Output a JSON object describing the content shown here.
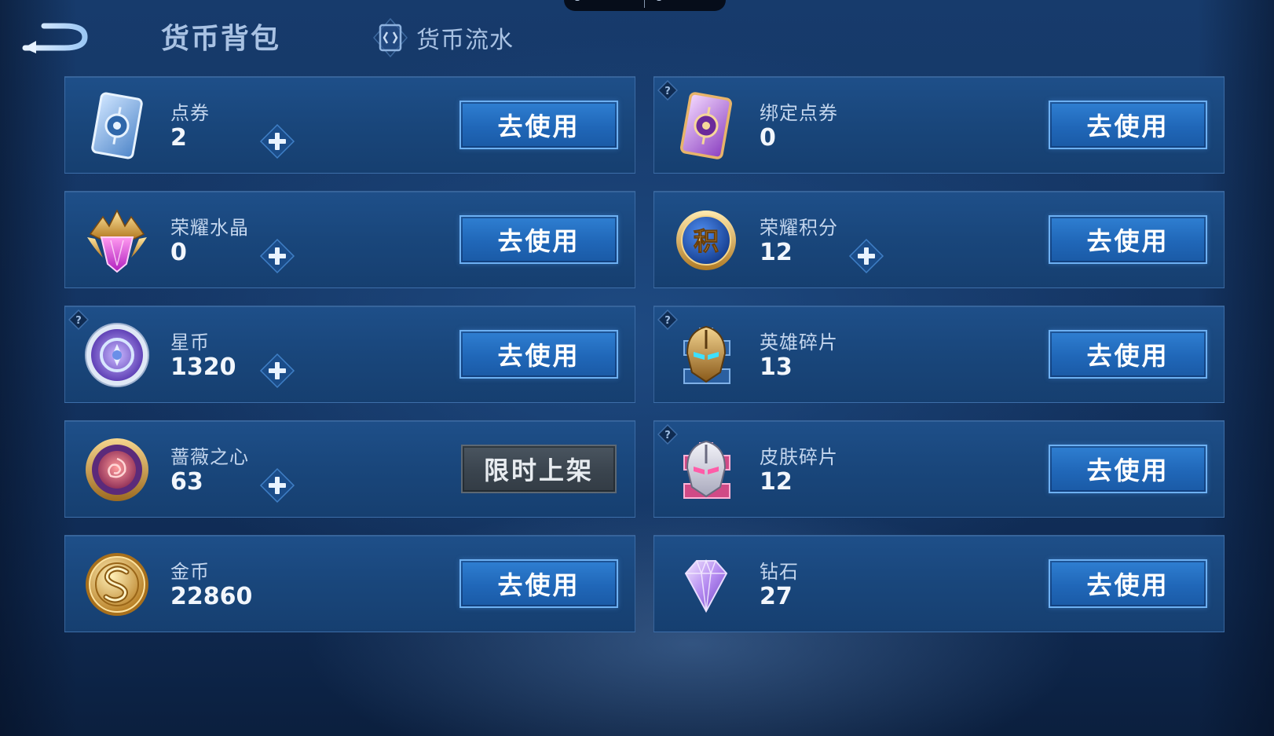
{
  "header": {
    "title": "货币背包",
    "flow_tab": "货币流水"
  },
  "buttons": {
    "use": "去使用",
    "limited": "限时上架"
  },
  "currencies": [
    {
      "name": "点券",
      "amount": "2",
      "icon": "coupon-card-icon",
      "addable": true,
      "button": "use",
      "help": false
    },
    {
      "name": "绑定点券",
      "amount": "0",
      "icon": "bound-coupon-card-icon",
      "addable": false,
      "button": "use",
      "help": true
    },
    {
      "name": "荣耀水晶",
      "amount": "0",
      "icon": "glory-crystal-icon",
      "addable": true,
      "button": "use",
      "help": false
    },
    {
      "name": "荣耀积分",
      "amount": "12",
      "icon": "glory-points-icon",
      "addable": true,
      "button": "use",
      "help": false
    },
    {
      "name": "星币",
      "amount": "1320",
      "icon": "star-coin-icon",
      "addable": true,
      "button": "use",
      "help": true
    },
    {
      "name": "英雄碎片",
      "amount": "13",
      "icon": "hero-fragment-icon",
      "addable": false,
      "button": "use",
      "help": true
    },
    {
      "name": "蔷薇之心",
      "amount": "63",
      "icon": "rose-heart-icon",
      "addable": true,
      "button": "limited",
      "help": false
    },
    {
      "name": "皮肤碎片",
      "amount": "12",
      "icon": "skin-fragment-icon",
      "addable": false,
      "button": "use",
      "help": true
    },
    {
      "name": "金币",
      "amount": "22860",
      "icon": "gold-coin-icon",
      "addable": false,
      "button": "use",
      "help": false
    },
    {
      "name": "钻石",
      "amount": "27",
      "icon": "diamond-icon",
      "addable": false,
      "button": "use",
      "help": false
    }
  ],
  "icon_glyphs": {
    "glory-points-icon": "积"
  },
  "colors": {
    "use_button": "#2067b8",
    "limited_button": "#3a444e",
    "card_background": "#19467b",
    "text_primary": "#f2f6fc",
    "text_label": "#c4d6ee"
  }
}
